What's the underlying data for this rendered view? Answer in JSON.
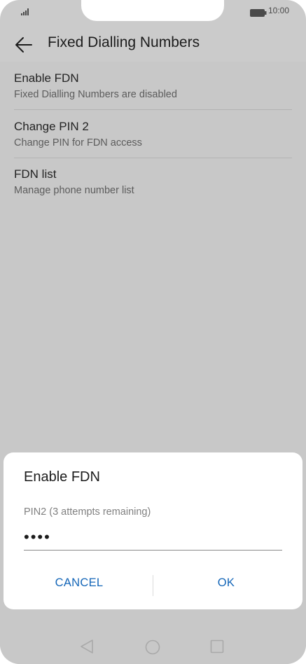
{
  "status_bar": {
    "time": "10:00",
    "icons": [
      "signal-icon",
      "battery-icon"
    ]
  },
  "app_bar": {
    "title": "Fixed Dialling Numbers",
    "back_icon": "back-arrow-icon"
  },
  "settings": {
    "items": [
      {
        "title": "Enable FDN",
        "subtitle": "Fixed Dialling Numbers are disabled"
      },
      {
        "title": "Change PIN 2",
        "subtitle": "Change PIN for FDN access"
      },
      {
        "title": "FDN list",
        "subtitle": "Manage phone number list"
      }
    ]
  },
  "dialog": {
    "title": "Enable FDN",
    "field_label": "PIN2 (3 attempts remaining)",
    "field_value_masked": "••••",
    "cancel_label": "CANCEL",
    "ok_label": "OK"
  },
  "nav_bar": {
    "icons": [
      "nav-back-icon",
      "nav-home-icon",
      "nav-recents-icon"
    ]
  },
  "colors": {
    "dimmed_background": "#c8c8c8",
    "dialog_background": "#ffffff",
    "accent": "#1466b8"
  }
}
